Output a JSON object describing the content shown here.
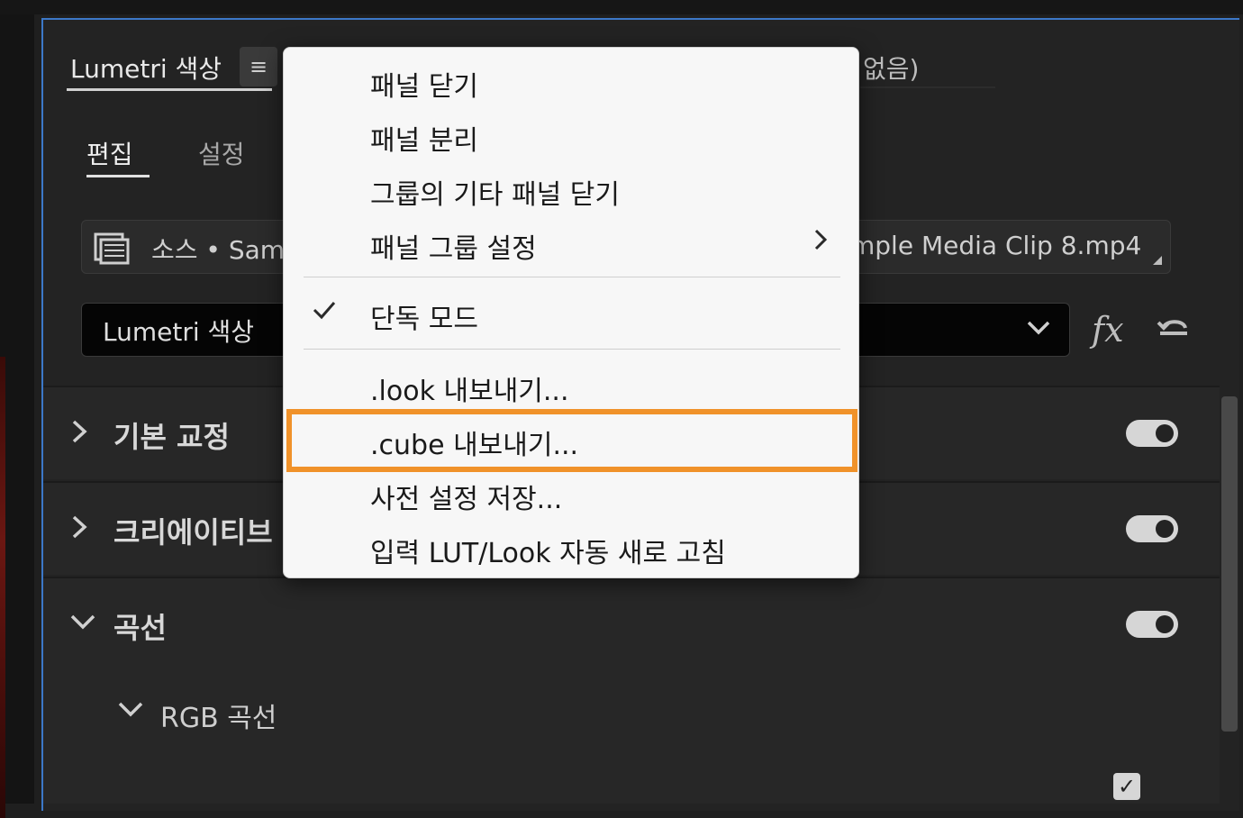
{
  "panel": {
    "tab_title": "Lumetri 색상",
    "menu_icon": "≡",
    "tab_right_fragment": "없음)",
    "subtabs": [
      {
        "label": "편집",
        "active": true
      },
      {
        "label": "설정",
        "active": false
      }
    ],
    "source": {
      "label": "소스 • Sam",
      "clip_fragment": "mple Media Clip 8.mp4"
    },
    "effect_select": {
      "value": "Lumetri 색상"
    },
    "fx_label": "fx",
    "sections": [
      {
        "label": "기본 교정",
        "expanded": false,
        "enabled": true
      },
      {
        "label": "크리에이티브",
        "expanded": false,
        "enabled": true
      },
      {
        "label": "곡선",
        "expanded": true,
        "enabled": true
      }
    ],
    "subsection": {
      "label": "RGB 곡선",
      "expanded": true
    },
    "checkbox_checked": true
  },
  "menu": {
    "items": [
      {
        "label": "패널 닫기"
      },
      {
        "label": "패널 분리"
      },
      {
        "label": "그룹의 기타 패널 닫기"
      },
      {
        "label": "패널 그룹 설정",
        "submenu": true
      },
      {
        "label": "단독 모드",
        "checked": true
      },
      {
        "label": ".look 내보내기..."
      },
      {
        "label": ".cube 내보내기...",
        "highlighted": true
      },
      {
        "label": "사전 설정 저장..."
      },
      {
        "label": "입력 LUT/Look 자동 새로 고침"
      }
    ]
  },
  "colors": {
    "panel_border": "#3c78c8",
    "highlight": "#f0922a",
    "menu_bg": "#f7f7f7",
    "background": "#1f1f1f"
  }
}
